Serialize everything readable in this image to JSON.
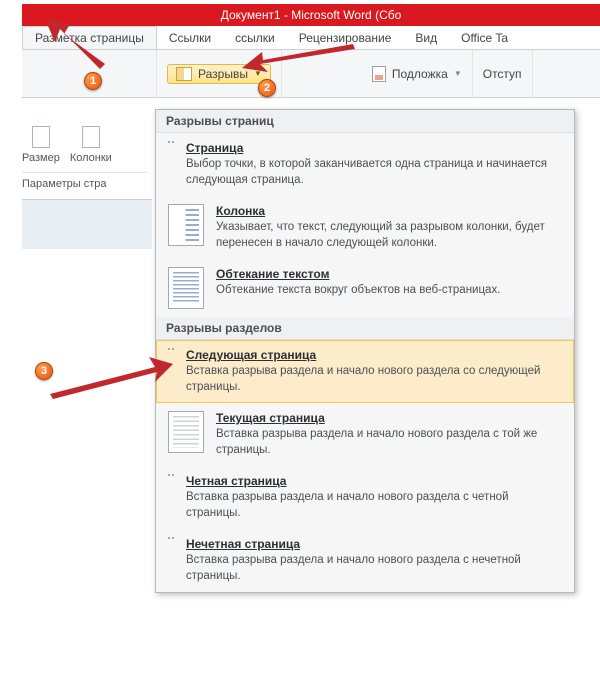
{
  "titlebar": "Документ1 - Microsoft Word (Сбо",
  "tabs": {
    "layout": "Разметка страницы",
    "links": "Ссылки",
    "mailings": "ссылки",
    "review": "Рецензирование",
    "view": "Вид",
    "office": "Office Ta"
  },
  "ribbon": {
    "breaks_label": "Разрывы",
    "watermark_label": "Подложка",
    "indent_label": "Отступ"
  },
  "small": {
    "size": "Размер",
    "columns": "Колонки",
    "caption": "Параметры стра"
  },
  "dropdown": {
    "section1": "Разрывы страниц",
    "section2": "Разрывы разделов",
    "items": {
      "page": {
        "title": "Страница",
        "desc": "Выбор точки, в которой заканчивается одна страница и начинается следующая страница."
      },
      "column": {
        "title": "Колонка",
        "desc": "Указывает, что текст, следующий за разрывом колонки, будет перенесен в начало следующей колонки."
      },
      "wrap": {
        "title": "Обтекание текстом",
        "desc": "Обтекание текста вокруг объектов на веб-страницах."
      },
      "next": {
        "title": "Следующая страница",
        "desc": "Вставка разрыва раздела и начало нового раздела со следующей страницы."
      },
      "cur": {
        "title": "Текущая страница",
        "desc": "Вставка разрыва раздела и начало нового раздела с той же страницы."
      },
      "even": {
        "title": "Четная страница",
        "desc": "Вставка разрыва раздела и начало нового раздела с четной страницы."
      },
      "odd": {
        "title": "Нечетная страница",
        "desc": "Вставка разрыва раздела и начало нового раздела с нечетной страницы."
      }
    }
  },
  "badges": {
    "one": "1",
    "two": "2",
    "three": "3"
  }
}
